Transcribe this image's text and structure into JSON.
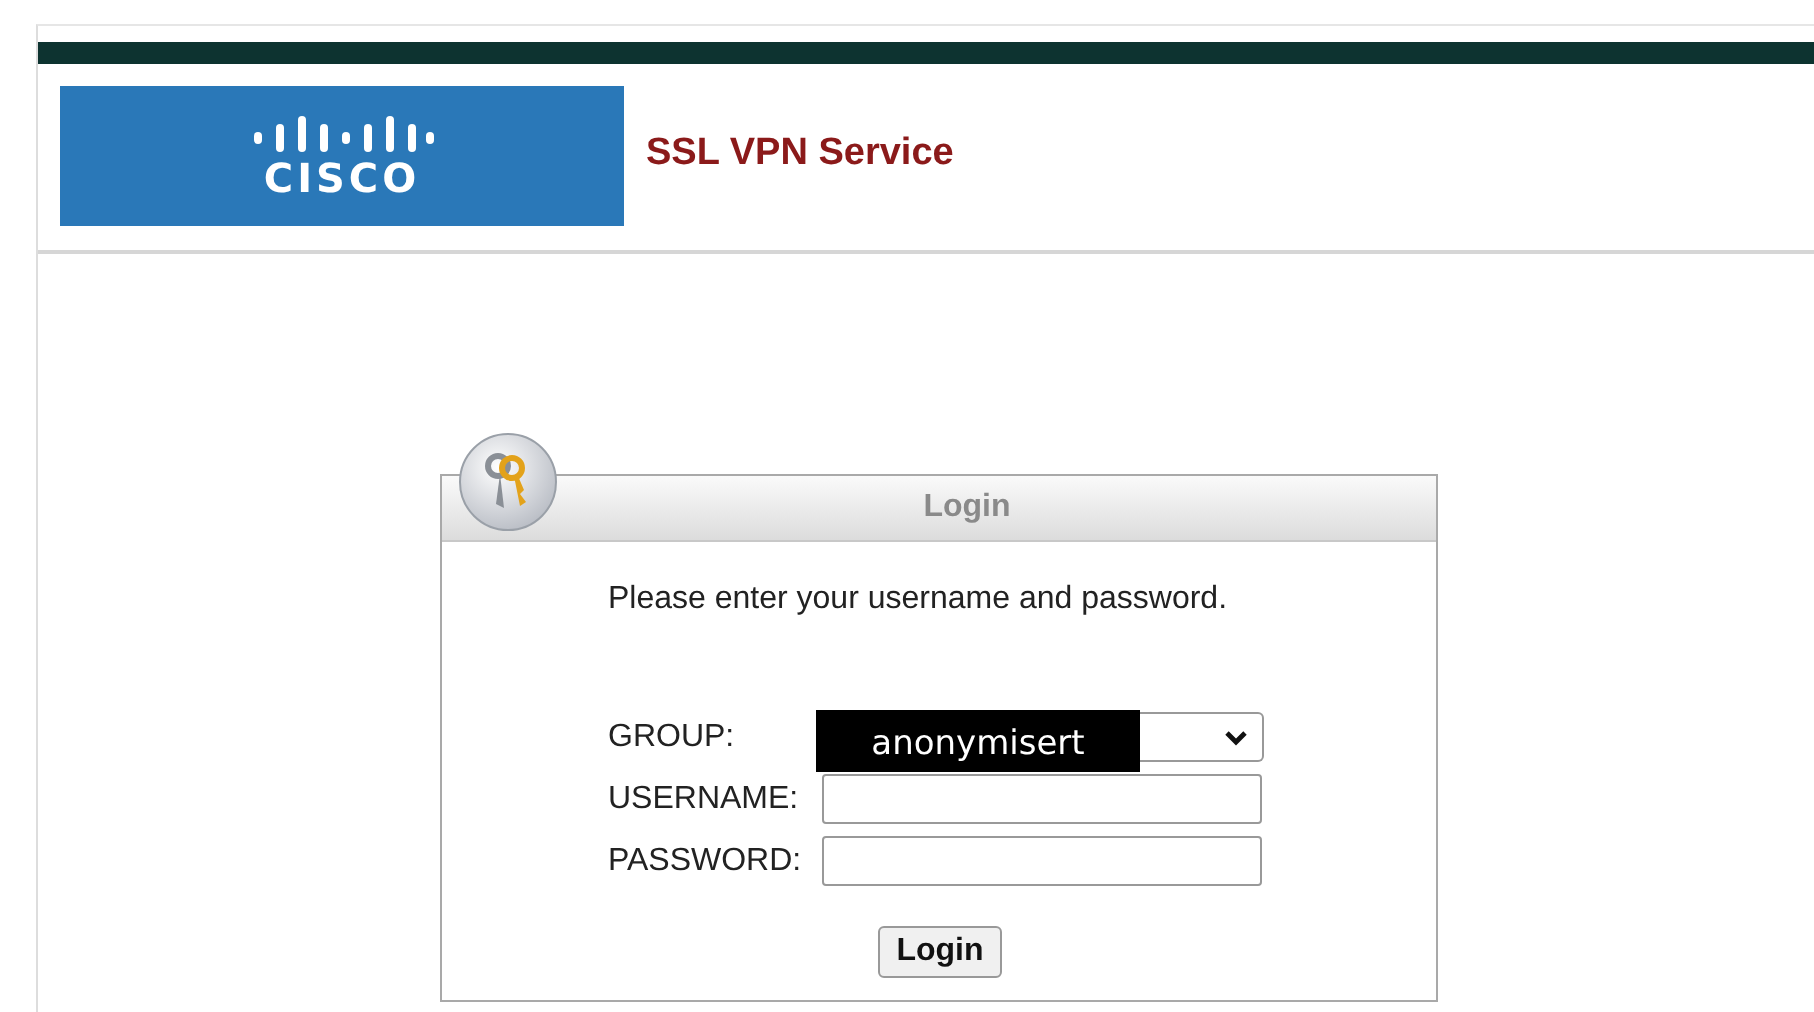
{
  "header": {
    "logo_text": "CISCO",
    "title": "SSL VPN Service"
  },
  "login": {
    "title": "Login",
    "instruction": "Please enter your username and password.",
    "fields": [
      {
        "kind": "select",
        "label": "GROUP:",
        "value": "anonymisert"
      },
      {
        "kind": "text",
        "label": "USERNAME:"
      },
      {
        "kind": "password",
        "label": "PASSWORD:"
      }
    ],
    "button": "Login"
  }
}
